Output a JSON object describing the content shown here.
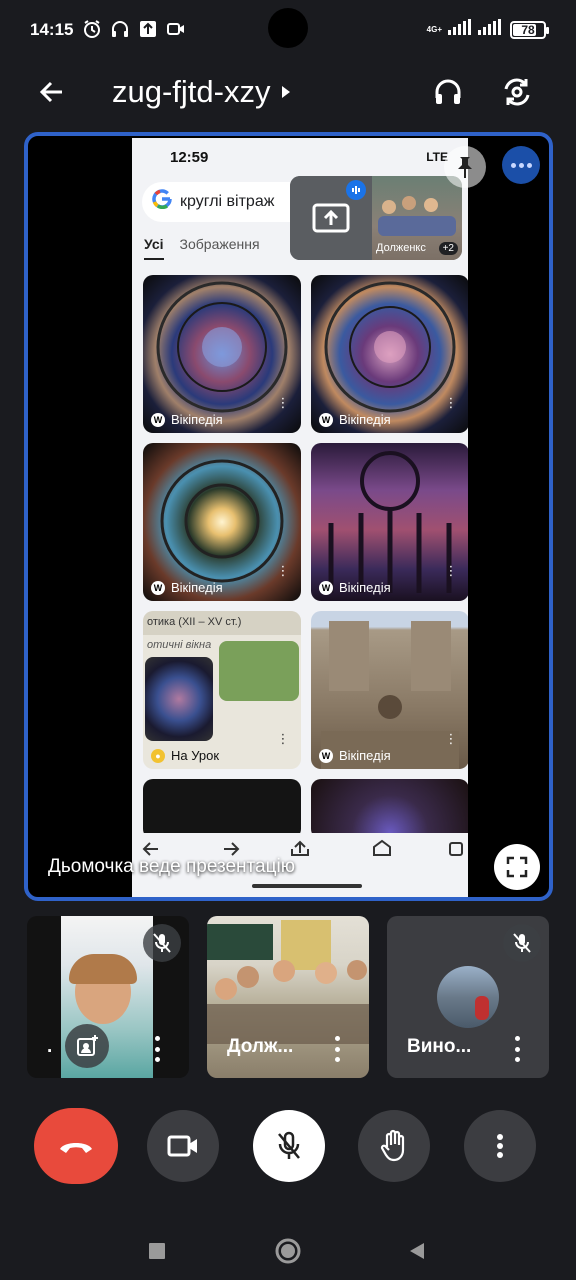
{
  "status_bar": {
    "time": "14:15",
    "network": "4G+",
    "battery": "78",
    "battery_level": 0.78
  },
  "header": {
    "meeting_code": "zug-fjtd-xzy"
  },
  "stage": {
    "presenting_text": "Дьомочка веде презентацію",
    "shared_phone": {
      "time": "12:59",
      "network": "LTE",
      "search_query": "круглі вітраж",
      "tabs": [
        "Усі",
        "Зображення"
      ],
      "results": [
        {
          "source": "Вікіпедія",
          "icon": "wikipedia-icon"
        },
        {
          "source": "Вікіпедія",
          "icon": "wikipedia-icon"
        },
        {
          "source": "Вікіпедія",
          "icon": "wikipedia-icon"
        },
        {
          "source": "Вікіпедія",
          "icon": "wikipedia-icon"
        },
        {
          "source": "На Урок",
          "icon": "naurok-icon"
        },
        {
          "source": "Вікіпедія",
          "icon": "wikipedia-icon"
        }
      ],
      "slide_title": "отика (XII – XV ст.)",
      "slide_subtitle": "отичні вікна"
    },
    "pip": {
      "name": "Долженкс",
      "extra_count": "+2"
    }
  },
  "participants": [
    {
      "name": ".",
      "muted": true
    },
    {
      "name": "Долж...",
      "muted": false
    },
    {
      "name": "Вино...",
      "muted": true
    }
  ],
  "controls": [
    "end-call",
    "camera",
    "microphone-muted",
    "raise-hand",
    "more-options"
  ],
  "colors": {
    "background": "#1a1b1f",
    "stage_border": "#2f62c9",
    "end_call": "#e84a3c",
    "tile": "#3c3d41"
  }
}
